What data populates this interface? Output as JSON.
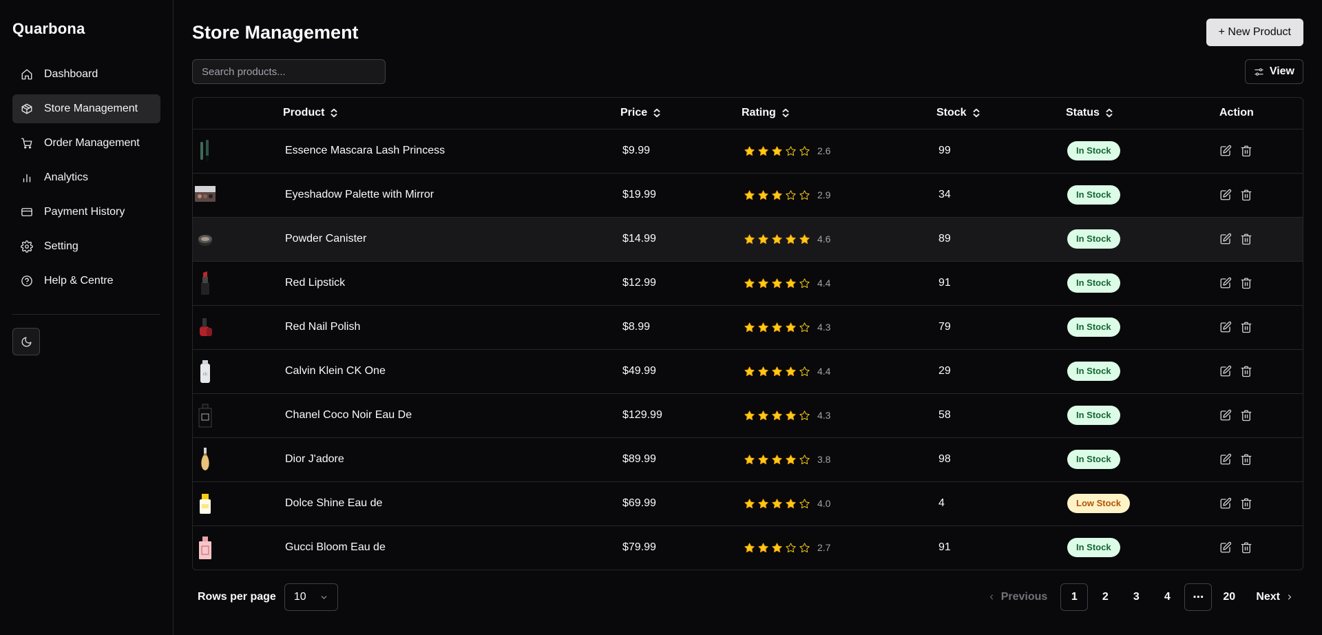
{
  "app": {
    "brand": "Quarbona"
  },
  "sidebar": {
    "items": [
      {
        "label": "Dashboard",
        "icon": "home-icon",
        "active": false
      },
      {
        "label": "Store Management",
        "icon": "package-icon",
        "active": true
      },
      {
        "label": "Order Management",
        "icon": "cart-icon",
        "active": false
      },
      {
        "label": "Analytics",
        "icon": "bar-chart-icon",
        "active": false
      },
      {
        "label": "Payment History",
        "icon": "credit-card-icon",
        "active": false
      },
      {
        "label": "Setting",
        "icon": "gear-icon",
        "active": false
      },
      {
        "label": "Help & Centre",
        "icon": "help-circle-icon",
        "active": false
      }
    ],
    "theme_toggle_icon": "moon-icon"
  },
  "header": {
    "title": "Store Management",
    "new_product_label": "+ New Product"
  },
  "toolbar": {
    "search_placeholder": "Search products...",
    "view_label": "View"
  },
  "table": {
    "columns": [
      "Product",
      "Price",
      "Rating",
      "Stock",
      "Status",
      "Action"
    ],
    "rows": [
      {
        "product": "Essence Mascara Lash Princess",
        "price": "$9.99",
        "rating": 2.6,
        "rating_label": "2.6",
        "stars_full": 3,
        "stock": "99",
        "status": "In Stock",
        "status_type": "in",
        "thumb": "mascara"
      },
      {
        "product": "Eyeshadow Palette with Mirror",
        "price": "$19.99",
        "rating": 2.9,
        "rating_label": "2.9",
        "stars_full": 3,
        "stock": "34",
        "status": "In Stock",
        "status_type": "in",
        "thumb": "palette"
      },
      {
        "product": "Powder Canister",
        "price": "$14.99",
        "rating": 4.6,
        "rating_label": "4.6",
        "stars_full": 5,
        "stock": "89",
        "status": "In Stock",
        "status_type": "in",
        "thumb": "powder"
      },
      {
        "product": "Red Lipstick",
        "price": "$12.99",
        "rating": 4.4,
        "rating_label": "4.4",
        "stars_full": 4,
        "stock": "91",
        "status": "In Stock",
        "status_type": "in",
        "thumb": "lipstick"
      },
      {
        "product": "Red Nail Polish",
        "price": "$8.99",
        "rating": 4.3,
        "rating_label": "4.3",
        "stars_full": 4,
        "stock": "79",
        "status": "In Stock",
        "status_type": "in",
        "thumb": "nailpolish"
      },
      {
        "product": "Calvin Klein CK One",
        "price": "$49.99",
        "rating": 4.4,
        "rating_label": "4.4",
        "stars_full": 4,
        "stock": "29",
        "status": "In Stock",
        "status_type": "in",
        "thumb": "ckone"
      },
      {
        "product": "Chanel Coco Noir Eau De",
        "price": "$129.99",
        "rating": 4.3,
        "rating_label": "4.3",
        "stars_full": 4,
        "stock": "58",
        "status": "In Stock",
        "status_type": "in",
        "thumb": "chanel"
      },
      {
        "product": "Dior J'adore",
        "price": "$89.99",
        "rating": 3.8,
        "rating_label": "3.8",
        "stars_full": 4,
        "stock": "98",
        "status": "In Stock",
        "status_type": "in",
        "thumb": "dior"
      },
      {
        "product": "Dolce Shine Eau de",
        "price": "$69.99",
        "rating": 4.0,
        "rating_label": "4.0",
        "stars_full": 4,
        "stock": "4",
        "status": "Low Stock",
        "status_type": "low",
        "thumb": "dolce"
      },
      {
        "product": "Gucci Bloom Eau de",
        "price": "$79.99",
        "rating": 2.7,
        "rating_label": "2.7",
        "stars_full": 3,
        "stock": "91",
        "status": "In Stock",
        "status_type": "in",
        "thumb": "gucci"
      }
    ]
  },
  "footer": {
    "rows_per_page_label": "Rows per page",
    "rows_per_page_value": "10",
    "previous_label": "Previous",
    "next_label": "Next",
    "pages": [
      "1",
      "2",
      "3",
      "4",
      "...",
      "20"
    ],
    "current_page": "1"
  },
  "colors": {
    "background": "#09090b",
    "star": "#facc15",
    "in_stock_bg": "#dcfce7",
    "in_stock_text": "#166534",
    "low_stock_bg": "#fef3c7",
    "low_stock_text": "#b45309"
  }
}
